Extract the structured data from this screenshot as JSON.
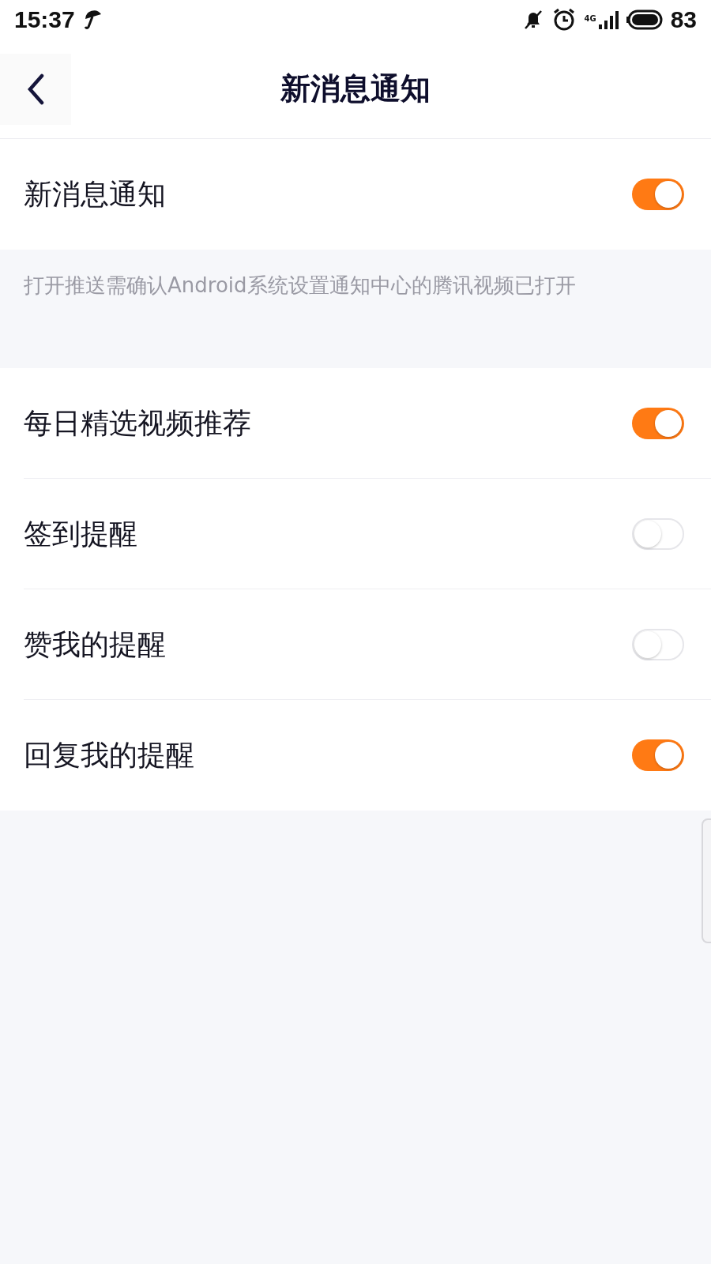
{
  "status_bar": {
    "time": "15:37",
    "network": "4G",
    "battery": "83"
  },
  "header": {
    "title": "新消息通知"
  },
  "main_toggle": {
    "label": "新消息通知",
    "on": true
  },
  "note": "打开推送需确认Android系统设置通知中心的腾讯视频已打开",
  "settings": [
    {
      "label": "每日精选视频推荐",
      "on": true
    },
    {
      "label": "签到提醒",
      "on": false
    },
    {
      "label": "赞我的提醒",
      "on": false
    },
    {
      "label": "回复我的提醒",
      "on": true
    }
  ]
}
